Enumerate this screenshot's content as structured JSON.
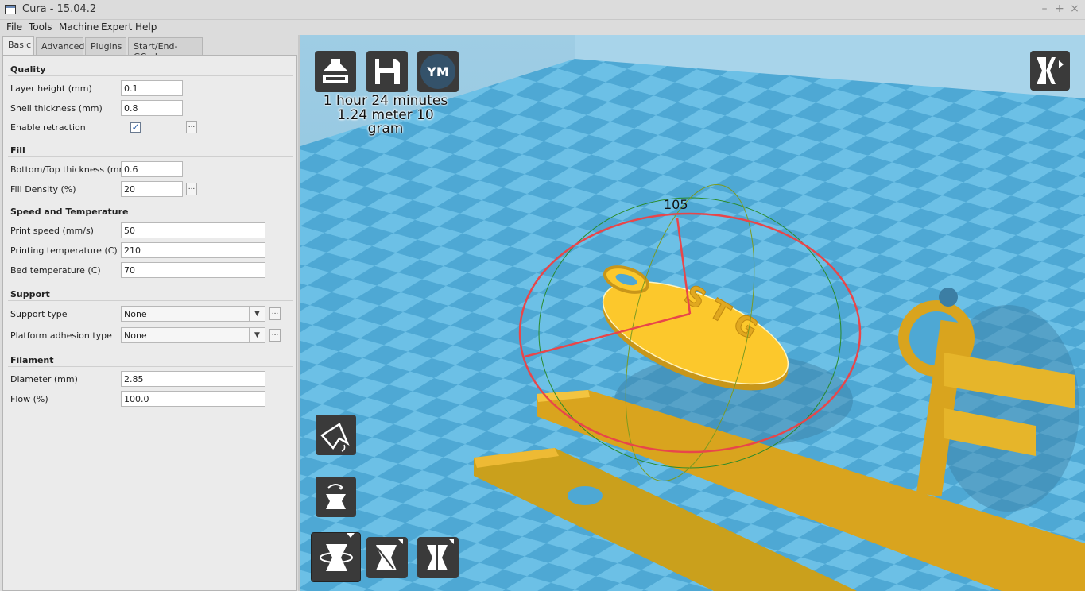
{
  "window": {
    "title": "Cura - 15.04.2",
    "controls": [
      "–",
      "+",
      "×"
    ]
  },
  "menu": [
    "File",
    "Tools",
    "Machine",
    "Expert",
    "Help"
  ],
  "tabs": [
    "Basic",
    "Advanced",
    "Plugins",
    "Start/End-GCode"
  ],
  "quality": {
    "title": "Quality",
    "layer_height_label": "Layer height (mm)",
    "layer_height": "0.1",
    "shell_label": "Shell thickness (mm)",
    "shell": "0.8",
    "retraction_label": "Enable retraction",
    "retraction_checked": true
  },
  "fill": {
    "title": "Fill",
    "bottom_top_label": "Bottom/Top thickness (mm)",
    "bottom_top": "0.6",
    "density_label": "Fill Density (%)",
    "density": "20"
  },
  "speed": {
    "title": "Speed and Temperature",
    "print_speed_label": "Print speed (mm/s)",
    "print_speed": "50",
    "print_temp_label": "Printing temperature (C)",
    "print_temp": "210",
    "bed_temp_label": "Bed temperature (C)",
    "bed_temp": "70"
  },
  "support": {
    "title": "Support",
    "type_label": "Support type",
    "type": "None",
    "adhesion_label": "Platform adhesion type",
    "adhesion": "None"
  },
  "filament": {
    "title": "Filament",
    "diameter_label": "Diameter (mm)",
    "diameter": "2.85",
    "flow_label": "Flow (%)",
    "flow": "100.0"
  },
  "more_button": "...",
  "viewport": {
    "print_time": "1 hour 24 minutes",
    "material": "1.24 meter 10 gram",
    "ym_label": "YM",
    "rotation_angle": "105",
    "colors": {
      "sky": "#5ab0d8",
      "model": "#f5be26",
      "ring": "#e8464a",
      "axis": "#2a8a2a"
    }
  },
  "icons": [
    "load-icon",
    "save-icon",
    "ym-icon",
    "view-mode-icon",
    "lay-flat-icon",
    "reset-rotation-icon",
    "rotate-icon",
    "scale-icon",
    "mirror-icon"
  ]
}
